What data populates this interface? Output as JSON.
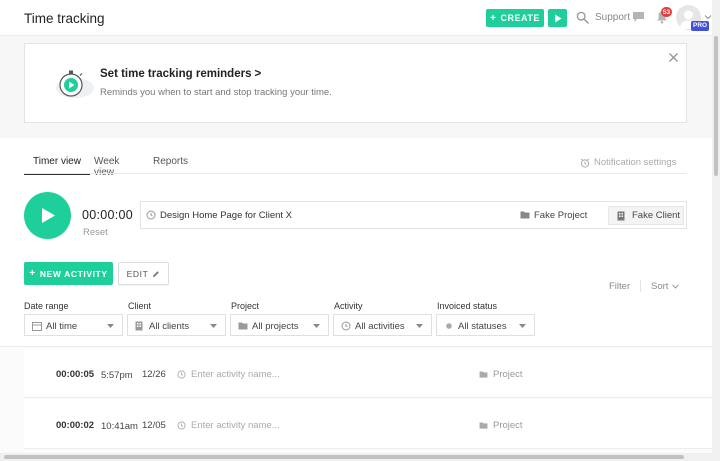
{
  "header": {
    "title": "Time tracking",
    "create_label": "CREATE",
    "support_label": "Support",
    "notification_count": "53",
    "pro_label": "PRO"
  },
  "reminder": {
    "title": "Set time tracking reminders",
    "title_chevron": ">",
    "subtitle": "Reminds you when to start and stop tracking your time."
  },
  "tabs": [
    {
      "label": "Timer view",
      "active": true
    },
    {
      "label": "Week view",
      "active": false
    },
    {
      "label": "Reports",
      "active": false
    }
  ],
  "notification_settings_label": "Notification settings",
  "timer": {
    "display": "00:00:00",
    "reset_label": "Reset",
    "description": "Design Home Page for Client X",
    "project": "Fake Project",
    "client": "Fake Client"
  },
  "actions": {
    "new_activity_label": "NEW ACTIVITY",
    "edit_label": "EDIT",
    "filter_label": "Filter",
    "sort_label": "Sort"
  },
  "filters": [
    {
      "label": "Date range",
      "value": "All time",
      "icon": "calendar-icon"
    },
    {
      "label": "Client",
      "value": "All clients",
      "icon": "building-icon"
    },
    {
      "label": "Project",
      "value": "All projects",
      "icon": "folder-icon"
    },
    {
      "label": "Activity",
      "value": "All activities",
      "icon": "clock-icon"
    },
    {
      "label": "Invoiced status",
      "value": "All statuses",
      "icon": "dot-icon"
    }
  ],
  "entries": [
    {
      "duration": "00:00:05",
      "time": "5:57pm",
      "date": "12/26",
      "activity_placeholder": "Enter activity name...",
      "project": "Project"
    },
    {
      "duration": "00:00:02",
      "time": "10:41am",
      "date": "12/05",
      "activity_placeholder": "Enter activity name...",
      "project": "Project"
    }
  ],
  "colors": {
    "accent": "#1fcf9b",
    "badge": "#e23c3c",
    "pro": "#4450d6"
  }
}
